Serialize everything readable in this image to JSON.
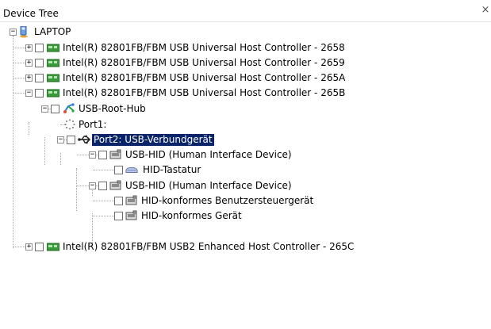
{
  "window": {
    "title": "Device Tree",
    "close_glyph": "×"
  },
  "tree": {
    "root": {
      "label": "LAPTOP",
      "expanded": true,
      "icon": "computer-icon"
    },
    "nodes": [
      {
        "id": "hc-2658",
        "label": "Intel(R) 82801FB/FBM USB Universal Host Controller - 2658",
        "icon": "pci-card-icon",
        "expander": "+"
      },
      {
        "id": "hc-2659",
        "label": "Intel(R) 82801FB/FBM USB Universal Host Controller - 2659",
        "icon": "pci-card-icon",
        "expander": "+"
      },
      {
        "id": "hc-265a",
        "label": "Intel(R) 82801FB/FBM USB Universal Host Controller - 265A",
        "icon": "pci-card-icon",
        "expander": "+"
      },
      {
        "id": "hc-265b",
        "label": "Intel(R) 82801FB/FBM USB Universal Host Controller - 265B",
        "icon": "pci-card-icon",
        "expander": "-"
      },
      {
        "id": "root-hub",
        "label": "USB-Root-Hub",
        "icon": "usb-hub-icon",
        "expander": "-"
      },
      {
        "id": "port1",
        "label": "Port1:",
        "icon": "empty-port-icon"
      },
      {
        "id": "port2",
        "label": "Port2: USB-Verbundgerät",
        "icon": "usb-plug-icon",
        "expander": "-",
        "selected": true
      },
      {
        "id": "hid-1",
        "label": "USB-HID (Human Interface Device)",
        "icon": "hid-device-icon",
        "expander": "-"
      },
      {
        "id": "hid-kbd",
        "label": "HID-Tastatur",
        "icon": "keyboard-icon"
      },
      {
        "id": "hid-2",
        "label": "USB-HID (Human Interface Device)",
        "icon": "hid-device-icon",
        "expander": "-"
      },
      {
        "id": "hid-consumer",
        "label": "HID-konformes Benutzersteuergerät",
        "icon": "hid-device-icon"
      },
      {
        "id": "hid-device",
        "label": "HID-konformes Gerät",
        "icon": "hid-device-icon"
      },
      {
        "id": "hc-265c",
        "label": "Intel(R) 82801FB/FBM USB2 Enhanced Host Controller - 265C",
        "icon": "pci-card-icon",
        "expander": "+"
      }
    ]
  },
  "colors": {
    "selection_bg": "#0a246a",
    "selection_fg": "#ffffff",
    "tree_lines": "#a0a0a0",
    "card_green": "#3a9a3a"
  }
}
